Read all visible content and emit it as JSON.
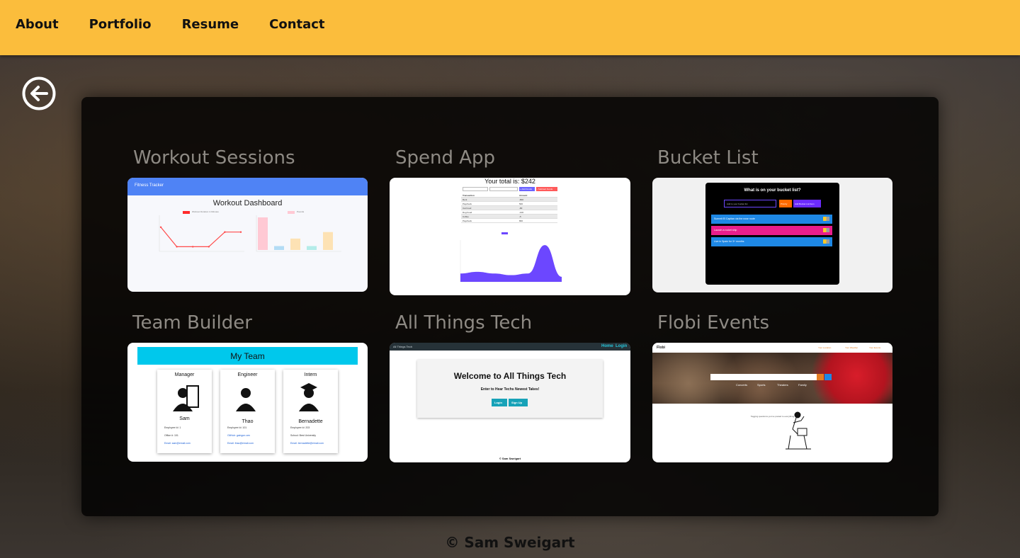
{
  "nav": {
    "items": [
      "About",
      "Portfolio",
      "Resume",
      "Contact"
    ]
  },
  "back_icon": "arrow-left-circle-icon",
  "projects": [
    {
      "title": "Workout Sessions",
      "preview": {
        "header": "Fitness Tracker",
        "heading": "Workout Dashboard",
        "legend_line": "Workout Duration in Minutes",
        "legend_bar": "Pounds",
        "line_values": [
          70,
          10,
          10,
          10,
          55,
          55
        ],
        "bar_values": [
          100,
          12,
          35,
          12,
          55
        ],
        "bar_colors": [
          "#ffc9d4",
          "#b3dcf5",
          "#fde2b4",
          "#b4ece9",
          "#fde2b4"
        ]
      }
    },
    {
      "title": "Spend App",
      "preview": {
        "total": "Your total is: $242",
        "add_label": "+ Add Funds",
        "sub_label": "- Subtract Funds",
        "columns": [
          "Transaction",
          "Amount"
        ],
        "rows": [
          [
            "Rent",
            "-800"
          ],
          [
            "Paycheck",
            "500"
          ],
          [
            "Cat Food",
            "-80"
          ],
          [
            "Dog Food",
            "-100"
          ],
          [
            "Coffee",
            "-5"
          ],
          [
            "Paycheck",
            "800"
          ]
        ],
        "area_values": [
          5,
          6,
          5,
          4,
          5,
          22,
          3
        ]
      }
    },
    {
      "title": "Bucket List",
      "preview": {
        "heading": "What is on your bucket list?",
        "input_placeholder": "Add to your bucket list",
        "priority_label": "Priority",
        "add_label": "Add Bucket List Item",
        "items": [
          {
            "text": "Summit El Capitan via the nose route",
            "color": "#1e88e5"
          },
          {
            "text": "Launch a rocket ship",
            "color": "#e91e8c"
          },
          {
            "text": "Live in Spain for 3+ months",
            "color": "#1e88e5"
          }
        ]
      }
    },
    {
      "title": "Team Builder",
      "preview": {
        "heading": "My Team",
        "members": [
          {
            "role": "Manager",
            "name": "Sam",
            "lines": [
              "Employee Id: 1",
              "Office #: 101",
              "Email: sam@email.com"
            ]
          },
          {
            "role": "Engineer",
            "name": "Thao",
            "lines": [
              "Employee Id: 101",
              "GitHub: gaingon-ven",
              "Email: thao@email.com"
            ]
          },
          {
            "role": "Intern",
            "name": "Bernadette",
            "lines": [
              "Employee Id: 203",
              "School: Best University",
              "Email: bernadette@email.com"
            ]
          }
        ]
      }
    },
    {
      "title": "All Things Tech",
      "preview": {
        "brand": "All Things Tech",
        "nav_links": [
          "Home",
          "Login"
        ],
        "heading": "Welcome to All Things Tech",
        "subheading": "Enter to Hear Techs Newest Takes!",
        "login_label": "Login",
        "signup_label": "Sign Up",
        "footer": "© Sam Sweigart"
      }
    },
    {
      "title": "Flobi Events",
      "preview": {
        "brand": "Flobi",
        "nav_links": [
          "Your Location",
          "Your Weather",
          "Your Events"
        ],
        "categories": [
          "Concerts",
          "Sports",
          "Theaters",
          "Family"
        ],
        "caption": "Tagging questions you've posted to everything"
      }
    }
  ],
  "footer": {
    "text": "© Sam Sweigart"
  }
}
